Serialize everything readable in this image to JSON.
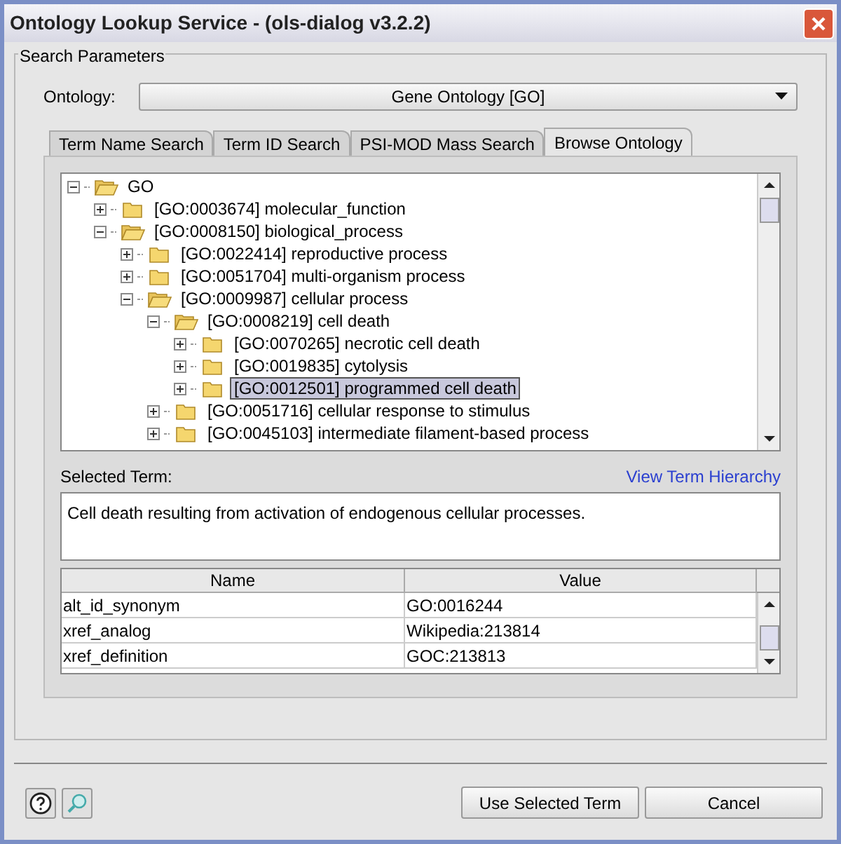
{
  "window": {
    "title": "Ontology Lookup Service - (ols-dialog v3.2.2)"
  },
  "search_parameters": {
    "legend": "Search Parameters",
    "ontology_label": "Ontology:",
    "ontology_value": "Gene Ontology [GO]"
  },
  "tabs": [
    {
      "label": "Term Name Search",
      "selected": false
    },
    {
      "label": "Term ID Search",
      "selected": false
    },
    {
      "label": "PSI-MOD Mass Search",
      "selected": false
    },
    {
      "label": "Browse Ontology",
      "selected": true
    }
  ],
  "tree": [
    {
      "label": "GO",
      "expanded": true,
      "selected": false,
      "children": [
        {
          "label": "[GO:0003674] molecular_function",
          "expanded": false,
          "selected": false
        },
        {
          "label": "[GO:0008150] biological_process",
          "expanded": true,
          "selected": false,
          "children": [
            {
              "label": "[GO:0022414] reproductive process",
              "expanded": false,
              "selected": false
            },
            {
              "label": "[GO:0051704] multi-organism process",
              "expanded": false,
              "selected": false
            },
            {
              "label": "[GO:0009987] cellular process",
              "expanded": true,
              "selected": false,
              "children": [
                {
                  "label": "[GO:0008219] cell death",
                  "expanded": true,
                  "selected": false,
                  "children": [
                    {
                      "label": "[GO:0070265] necrotic cell death",
                      "expanded": false,
                      "selected": false
                    },
                    {
                      "label": "[GO:0019835] cytolysis",
                      "expanded": false,
                      "selected": false
                    },
                    {
                      "label": "[GO:0012501] programmed cell death",
                      "expanded": false,
                      "selected": true
                    }
                  ]
                },
                {
                  "label": "[GO:0051716] cellular response to stimulus",
                  "expanded": false,
                  "selected": false
                },
                {
                  "label": "[GO:0045103] intermediate filament-based process",
                  "expanded": false,
                  "selected": false
                }
              ]
            }
          ]
        }
      ]
    }
  ],
  "selected_term": {
    "label": "Selected Term:",
    "link": "View Term Hierarchy",
    "description": "Cell death resulting from activation of endogenous cellular processes."
  },
  "table": {
    "columns": [
      "Name",
      "Value"
    ],
    "rows": [
      [
        "alt_id_synonym",
        "GO:0016244"
      ],
      [
        "xref_analog",
        "Wikipedia:213814"
      ],
      [
        "xref_definition",
        "GOC:213813"
      ]
    ]
  },
  "buttons": [
    {
      "kind": "help"
    },
    {
      "kind": "search"
    },
    {
      "kind": "text",
      "label": "Use Selected Term"
    },
    {
      "kind": "text",
      "label": "Cancel"
    }
  ]
}
